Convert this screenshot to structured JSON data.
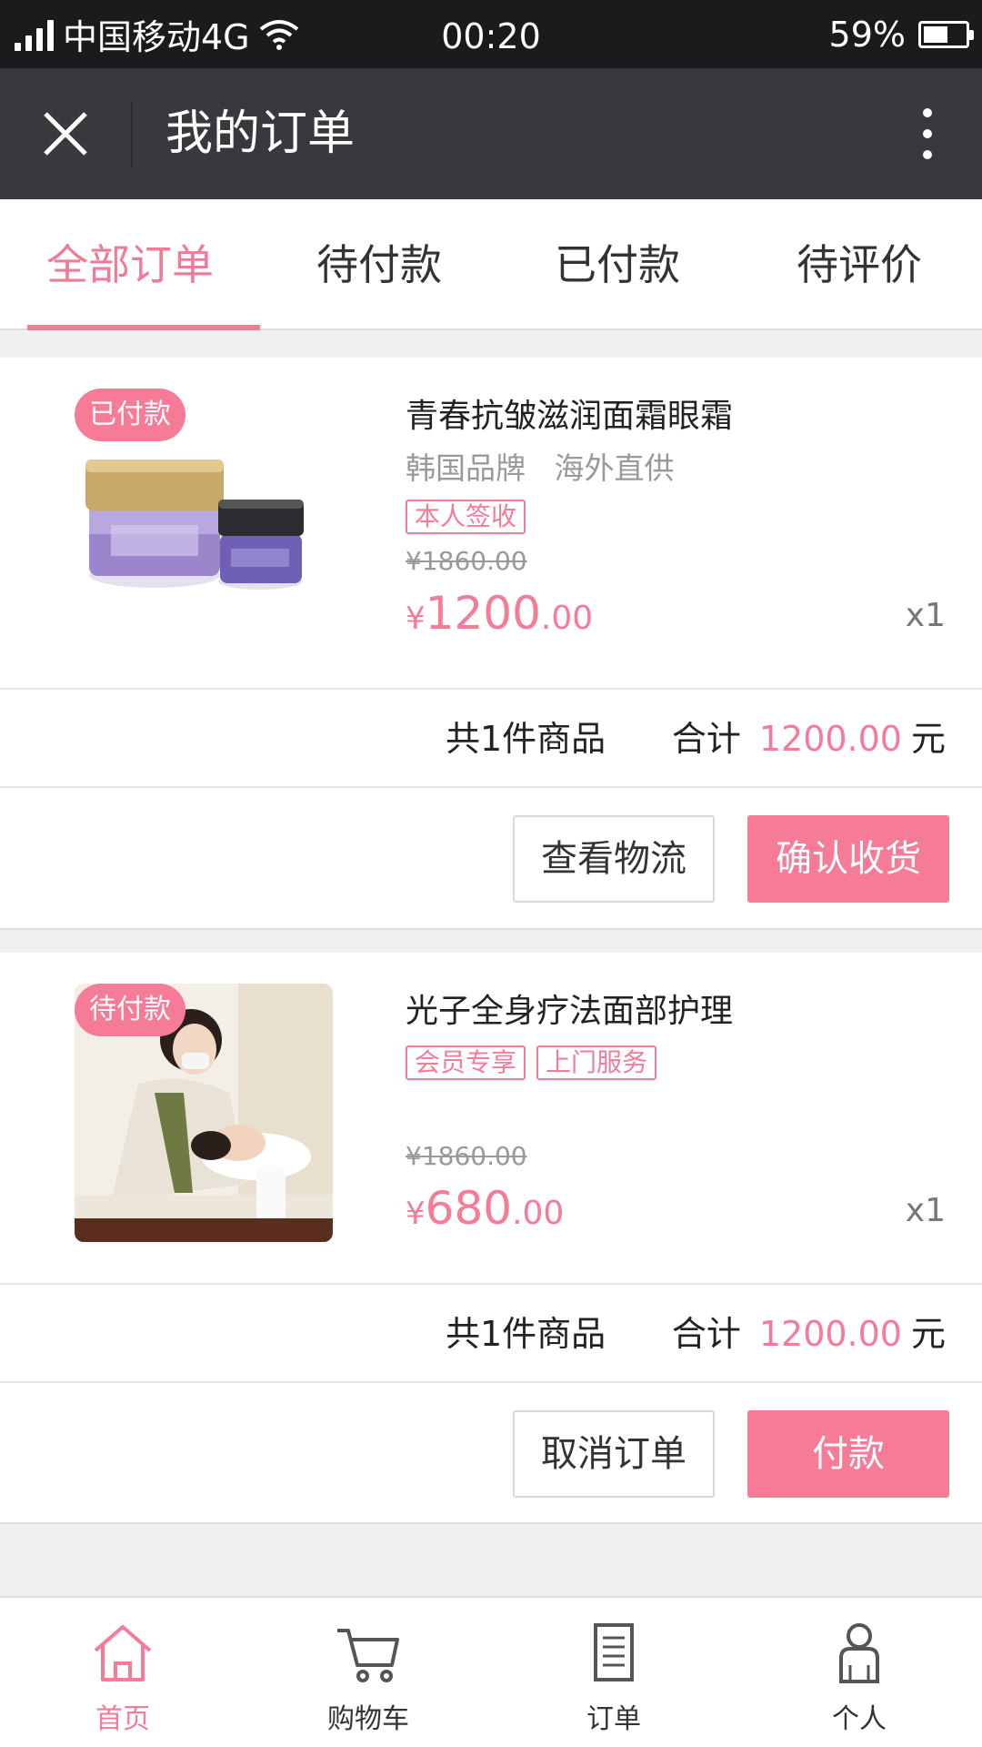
{
  "status_bar": {
    "carrier": "中国移动4G",
    "time": "00:20",
    "battery_percent": "59%",
    "battery_level": 0.59
  },
  "header": {
    "title": "我的订单"
  },
  "tabs": [
    {
      "label": "全部订单",
      "active": true
    },
    {
      "label": "待付款",
      "active": false
    },
    {
      "label": "已付款",
      "active": false
    },
    {
      "label": "待评价",
      "active": false
    }
  ],
  "orders": [
    {
      "badge": "已付款",
      "name": "青春抗皱滋润面霜眼霜",
      "subtitle": "韩国品牌   海外直供",
      "tags": [
        "本人签收"
      ],
      "original_price": "¥1860.00",
      "price_symbol": "¥",
      "price_integer": "1200",
      "price_decimal": ".00",
      "quantity": "x1",
      "count_text": "共1件商品",
      "total_label": "合计",
      "total_amount": "1200.00",
      "total_unit": "元",
      "secondary_button": "查看物流",
      "primary_button": "确认收货"
    },
    {
      "badge": "待付款",
      "name": "光子全身疗法面部护理",
      "subtitle": "",
      "tags": [
        "会员专享",
        "上门服务"
      ],
      "original_price": "¥1860.00",
      "price_symbol": "¥",
      "price_integer": "680",
      "price_decimal": ".00",
      "quantity": "x1",
      "count_text": "共1件商品",
      "total_label": "合计",
      "total_amount": "1200.00",
      "total_unit": "元",
      "secondary_button": "取消订单",
      "primary_button": "付款"
    }
  ],
  "bottom_nav": [
    {
      "label": "首页",
      "icon": "home-icon",
      "active": true
    },
    {
      "label": "购物车",
      "icon": "cart-icon",
      "active": false
    },
    {
      "label": "订单",
      "icon": "order-list-icon",
      "active": false
    },
    {
      "label": "个人",
      "icon": "person-icon",
      "active": false
    }
  ],
  "colors": {
    "accent": "#f57b97",
    "header_bg": "#38393d",
    "status_bg": "#1b1b1d"
  }
}
